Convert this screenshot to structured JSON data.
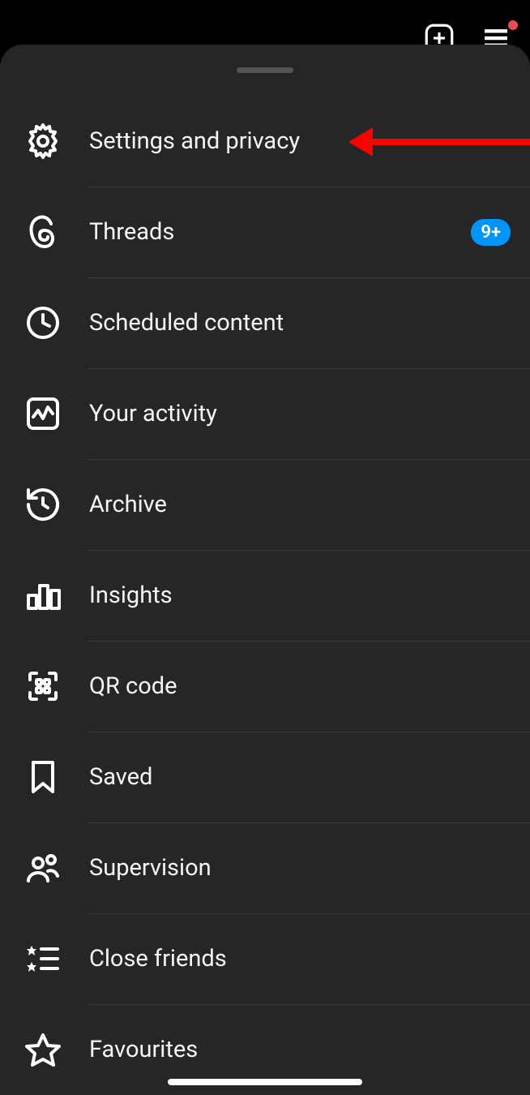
{
  "badge_threads": "9+",
  "menu": {
    "settings": "Settings and privacy",
    "threads": "Threads",
    "scheduled": "Scheduled content",
    "activity": "Your activity",
    "archive": "Archive",
    "insights": "Insights",
    "qr": "QR code",
    "saved": "Saved",
    "supervision": "Supervision",
    "close_friends": "Close friends",
    "favourites": "Favourites"
  }
}
